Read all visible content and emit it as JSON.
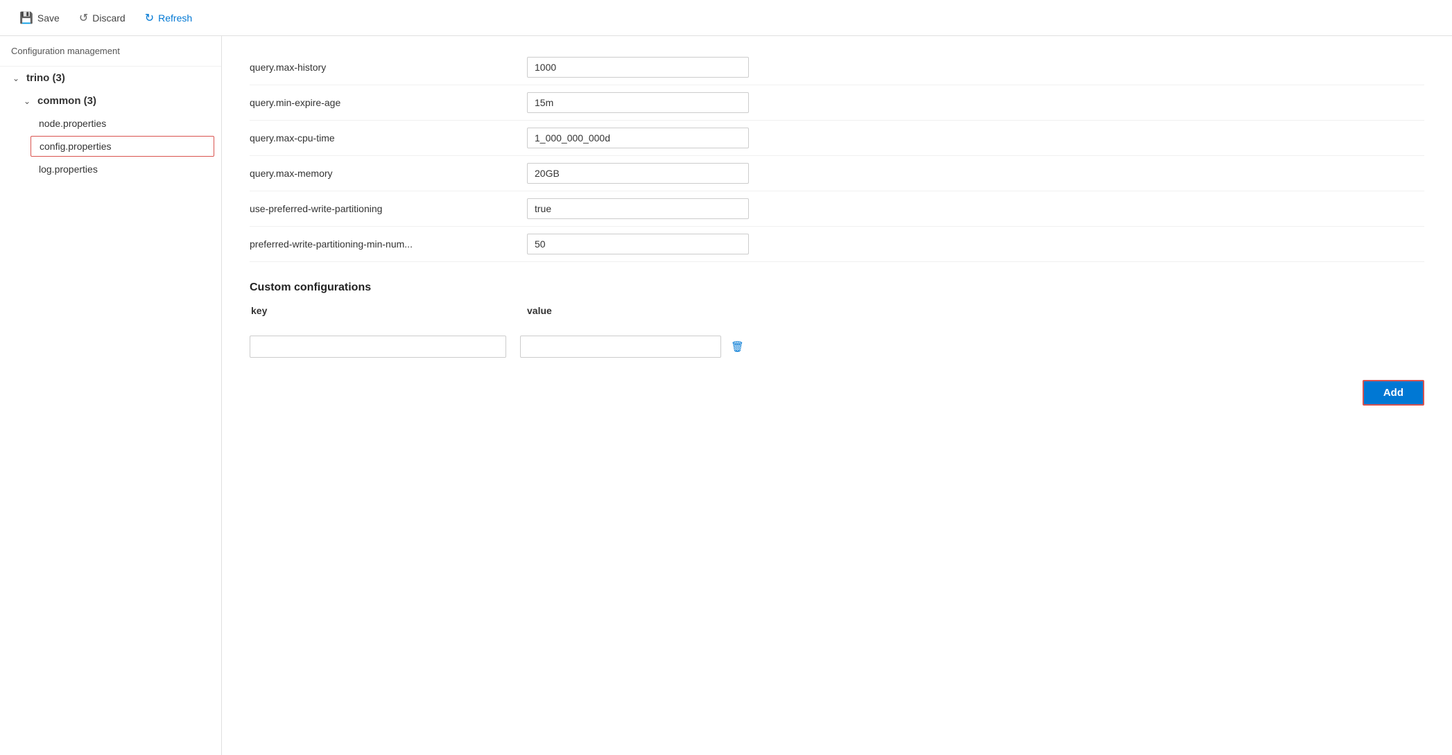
{
  "toolbar": {
    "save_label": "Save",
    "discard_label": "Discard",
    "refresh_label": "Refresh"
  },
  "sidebar": {
    "header": "Configuration management",
    "tree": [
      {
        "id": "trino",
        "label": "trino (3)",
        "level": 0,
        "expanded": true,
        "children": [
          {
            "id": "common",
            "label": "common (3)",
            "level": 1,
            "expanded": true,
            "children": [
              {
                "id": "node-properties",
                "label": "node.properties",
                "level": 2,
                "selected": false
              },
              {
                "id": "config-properties",
                "label": "config.properties",
                "level": 2,
                "selected": true
              },
              {
                "id": "log-properties",
                "label": "log.properties",
                "level": 2,
                "selected": false
              }
            ]
          }
        ]
      }
    ]
  },
  "main": {
    "config_rows": [
      {
        "key": "query.max-history",
        "value": "1000"
      },
      {
        "key": "query.min-expire-age",
        "value": "15m"
      },
      {
        "key": "query.max-cpu-time",
        "value": "1_000_000_000d"
      },
      {
        "key": "query.max-memory",
        "value": "20GB"
      },
      {
        "key": "use-preferred-write-partitioning",
        "value": "true"
      },
      {
        "key": "preferred-write-partitioning-min-num...",
        "value": "50"
      }
    ],
    "custom_section_title": "Custom configurations",
    "custom_key_header": "key",
    "custom_value_header": "value",
    "add_button_label": "Add"
  }
}
